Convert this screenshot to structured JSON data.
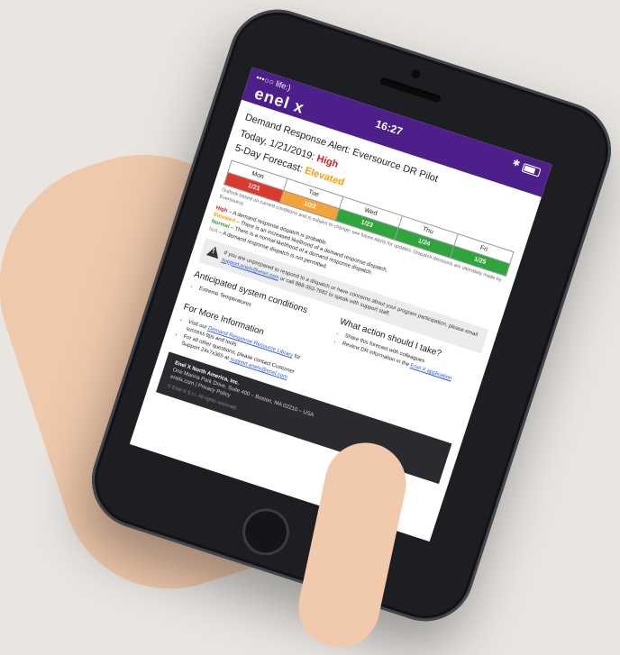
{
  "status": {
    "carrier": "•••○○ life:)",
    "time": "16:27"
  },
  "brand": "enel x",
  "alert": {
    "title": "Demand Response Alert: Eversource DR Pilot",
    "today_label": "Today, 1/21/2019: ",
    "today_level": "High",
    "forecast_label": "5-Day Forecast: ",
    "forecast_level": "Elevated"
  },
  "forecast": {
    "days": [
      "Mon",
      "Tue",
      "Wed",
      "Thu",
      "Fri"
    ],
    "dates": [
      "1/21",
      "1/22",
      "1/23",
      "1/24",
      "1/25"
    ],
    "colors": [
      "#d93a2c",
      "#f2a43a",
      "#2ea63c",
      "#2ea63c",
      "#2ea63c"
    ]
  },
  "note": "Outlook based on current conditions and is subject to change; see future alerts for updates. Dispatch decisions are ultimately made by Eversource.",
  "legend": {
    "high": "High",
    "high_text": " – A demand response dispatch is probable.",
    "elevated": "Elevated",
    "elevated_text": " – There is an increased likelihood of a demand response dispatch.",
    "normal": "Normal",
    "normal_text": " – There is a normal likelihood of a demand response dispatch.",
    "na": "N/A",
    "na_text": " – A demand response dispatch is not permitted."
  },
  "warning": {
    "text1": "If you are unprepared to respond to a dispatch or have concerns about your program participation, please email ",
    "email": "support.enelx@enel.com",
    "text2": " or call 888-363-7682 to speak with support staff."
  },
  "anticipated": {
    "heading": "Anticipated system conditions",
    "items": [
      "Extreme Temperatures"
    ]
  },
  "actions": {
    "heading": "What action should I take?",
    "items": [
      "Share this forecast with colleagues",
      "Review DR information in the "
    ],
    "app_link": "Enel X application"
  },
  "more_info": {
    "heading": "For More Information",
    "visit_prefix": "Visit our ",
    "library_link": "Demand Response Resource Library",
    "visit_suffix": " for success tips and tools.",
    "other_prefix": "For all other questions, please contact Customer Support 24x7x365 at ",
    "support_link": "support.enelx@enel.com"
  },
  "footer": {
    "company": "Enel X North America, Inc.",
    "address": "One Marina Park Drive, Suite 400 – Boston, MA 02210 – USA",
    "links": "enelx.com | Privacy Policy",
    "copyright": "© Enel X S.r.l. All rights reserved."
  }
}
